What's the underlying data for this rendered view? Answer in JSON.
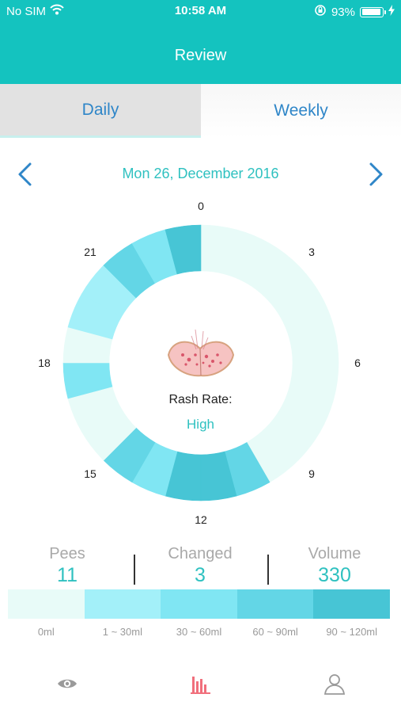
{
  "status_bar": {
    "carrier": "No SIM",
    "time": "10:58 AM",
    "battery": "93%",
    "battery_level": 0.93,
    "icons": [
      "wifi-icon",
      "orientation-lock-icon",
      "battery-icon",
      "charging-bolt-icon"
    ]
  },
  "nav": {
    "title": "Review"
  },
  "tabs": [
    {
      "label": "Daily",
      "selected": true
    },
    {
      "label": "Weekly",
      "selected": false
    }
  ],
  "date_nav": {
    "date": "Mon 26, December 2016",
    "prev_icon": "chevron-left-icon",
    "next_icon": "chevron-right-icon"
  },
  "clock_chart": {
    "hour_labels": [
      "0",
      "3",
      "6",
      "9",
      "12",
      "15",
      "18",
      "21"
    ],
    "rash_label": "Rash Rate:",
    "rash_value": "High",
    "center_icon": "rash-icon"
  },
  "chart_data": {
    "type": "heatmap",
    "unit_hours": 1,
    "hour_levels": [
      0,
      0,
      0,
      0,
      0,
      0,
      0,
      0,
      0,
      0,
      3,
      4,
      4,
      2,
      3,
      0,
      0,
      2,
      0,
      1,
      1,
      3,
      2,
      4
    ],
    "level_labels": [
      "0ml",
      "1 ~ 30ml",
      "30 ~ 60ml",
      "60 ~ 90ml",
      "90 ~ 120ml"
    ],
    "level_colors": [
      "#e8fbf8",
      "#a3f0f9",
      "#80e6f3",
      "#63d6e6",
      "#47c5d5"
    ]
  },
  "stats": [
    {
      "label": "Pees",
      "value": "11"
    },
    {
      "label": "Changed",
      "value": "3"
    },
    {
      "label": "Volume",
      "value": "330"
    }
  ],
  "legend": {
    "labels": [
      "0ml",
      "1 ~ 30ml",
      "30 ~ 60ml",
      "60 ~ 90ml",
      "90 ~ 120ml"
    ],
    "colors": [
      "#e8fbf8",
      "#a3f0f9",
      "#80e6f3",
      "#63d6e6",
      "#47c5d5"
    ]
  },
  "tab_bar": {
    "items": [
      {
        "icon": "eye-icon",
        "active": false
      },
      {
        "icon": "bar-chart-icon",
        "active": true
      },
      {
        "icon": "profile-icon",
        "active": false
      }
    ]
  },
  "colors": {
    "header": "#14c3bf",
    "accent_text": "#2fc1c0",
    "tab_text": "#2f86c8",
    "active_tab_icon": "#f06f7c",
    "inactive_tab_icon": "#9a9a9a"
  }
}
